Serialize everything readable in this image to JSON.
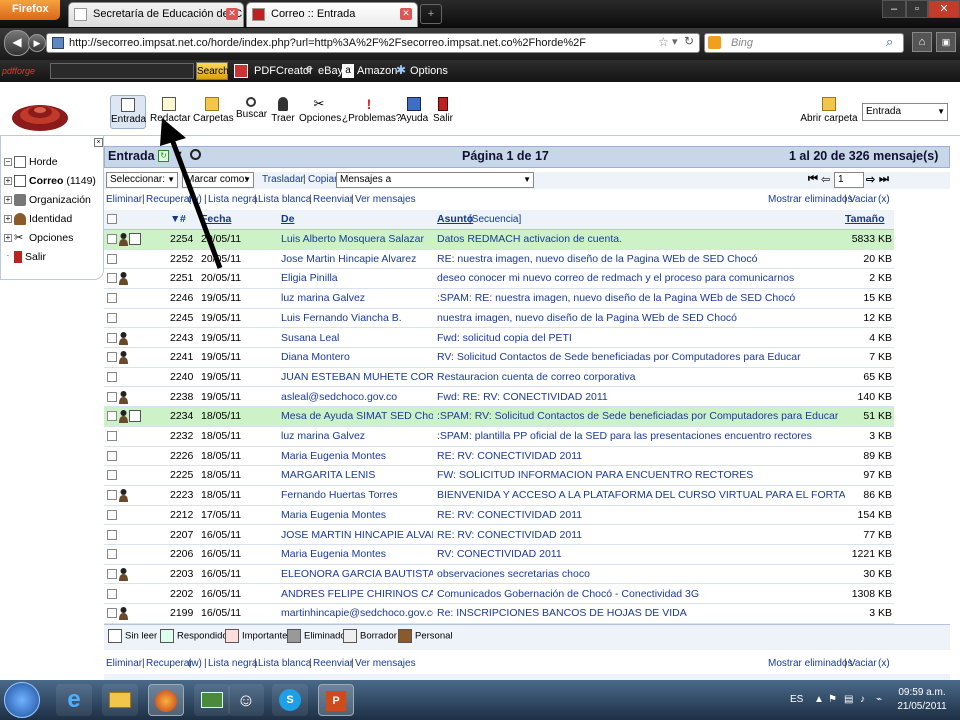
{
  "browser": {
    "app_button": "Firefox",
    "tabs": [
      {
        "label": "Secretaría de Educación del Chocó"
      },
      {
        "label": "Correo :: Entrada"
      }
    ],
    "url": "http://secorreo.impsat.net.co/horde/index.php?url=http%3A%2F%2Fsecorreo.impsat.net.co%2Fhorde%2F",
    "search_placeholder": "Bing",
    "bookmarks": {
      "search_placeholder": "",
      "search_button": "Search",
      "items": [
        "PDFCreator",
        "eBay",
        "Amazon",
        "Options"
      ]
    }
  },
  "toolbar": {
    "buttons": [
      "Entrada",
      "Redactar",
      "Carpetas",
      "Buscar",
      "Traer",
      "Opciones",
      "¿Problemas?",
      "Ayuda",
      "Salir"
    ],
    "open_folder": "Abrir carpeta",
    "folder_select": "Entrada"
  },
  "sidebar": {
    "items": [
      {
        "label": "Horde",
        "count": ""
      },
      {
        "label": "Correo",
        "count": "(1149)"
      },
      {
        "label": "Organización",
        "count": ""
      },
      {
        "label": "Identidad",
        "count": ""
      },
      {
        "label": "Opciones",
        "count": ""
      },
      {
        "label": "Salir",
        "count": ""
      }
    ]
  },
  "mailbox": {
    "title": "Entrada",
    "page": "Página 1 de 17",
    "range": "1 al 20 de 326 mensaje(s)",
    "select_label": "Seleccionar:",
    "mark_label": "Marcar como:",
    "move_label": "Trasladar",
    "copy_label": "Copiar",
    "messages_to": "Mensajes a",
    "page_input": "1",
    "actions": [
      "Eliminar",
      "Recuperar",
      "(w)",
      "Lista negra",
      "Lista blanca",
      "Reenviar",
      "Ver mensajes"
    ],
    "show_deleted": "Mostrar eliminados",
    "empty": "Vaciar",
    "empty_key": "(x)",
    "columns": {
      "num": "#",
      "date": "Fecha",
      "from": "De",
      "subject": "Asunto",
      "sequence": "[Secuencia]",
      "size": "Tamaño"
    },
    "rows": [
      {
        "num": "2254",
        "date": "20/05/11",
        "from": "Luis Alberto Mosquera Salazar",
        "subject": "Datos REDMACH activacion de cuenta.",
        "size": "5833 KB",
        "green": true,
        "person": true,
        "replied": true
      },
      {
        "num": "2252",
        "date": "20/05/11",
        "from": "Jose Martin Hincapie Alvarez",
        "subject": "RE: nuestra imagen, nuevo diseño de la Pagina WEb de SED Chocó",
        "size": "20 KB",
        "green": false,
        "person": false,
        "replied": false
      },
      {
        "num": "2251",
        "date": "20/05/11",
        "from": "Eligia Pinilla",
        "subject": "deseo conocer mi nuevo correo de redmach y el proceso para comunicarnos",
        "size": "2 KB",
        "green": false,
        "person": true,
        "replied": false
      },
      {
        "num": "2246",
        "date": "19/05/11",
        "from": "luz marina Galvez",
        "subject": ":SPAM: RE: nuestra imagen, nuevo diseño de la Pagina WEb de SED Chocó",
        "size": "15 KB",
        "green": false,
        "person": false,
        "replied": false
      },
      {
        "num": "2245",
        "date": "19/05/11",
        "from": "Luis Fernando Viancha B.",
        "subject": "nuestra imagen, nuevo diseño de la Pagina WEb de SED Chocó",
        "size": "12 KB",
        "green": false,
        "person": false,
        "replied": false
      },
      {
        "num": "2243",
        "date": "19/05/11",
        "from": "Susana Leal",
        "subject": "Fwd: solicitud copia del PETI",
        "size": "4 KB",
        "green": false,
        "person": true,
        "replied": false
      },
      {
        "num": "2241",
        "date": "19/05/11",
        "from": "Diana Montero",
        "subject": "RV: Solicitud Contactos de Sede beneficiadas por Computadores para Educar",
        "size": "7 KB",
        "green": false,
        "person": true,
        "replied": false
      },
      {
        "num": "2240",
        "date": "19/05/11",
        "from": "JUAN ESTEBAN MUHETE CORTES",
        "subject": "Restauracion cuenta de correo corporativa",
        "size": "65 KB",
        "green": false,
        "person": false,
        "replied": false
      },
      {
        "num": "2238",
        "date": "19/05/11",
        "from": "asleal@sedchoco.gov.co",
        "subject": "Fwd: RE: RV: CONECTIVIDAD 2011",
        "size": "140 KB",
        "green": false,
        "person": true,
        "replied": false
      },
      {
        "num": "2234",
        "date": "18/05/11",
        "from": "Mesa de Ayuda SIMAT SED Chocó",
        "subject": ":SPAM: RV: Solicitud Contactos de Sede beneficiadas por Computadores para Educar",
        "size": "51 KB",
        "green": true,
        "person": true,
        "replied": true
      },
      {
        "num": "2232",
        "date": "18/05/11",
        "from": "luz marina Galvez",
        "subject": ":SPAM: plantilla PP oficial de la SED  para las presentaciones encuentro rectores",
        "size": "3 KB",
        "green": false,
        "person": false,
        "replied": false
      },
      {
        "num": "2226",
        "date": "18/05/11",
        "from": "Maria Eugenia Montes",
        "subject": "RE: RV: CONECTIVIDAD 2011",
        "size": "89 KB",
        "green": false,
        "person": false,
        "replied": false
      },
      {
        "num": "2225",
        "date": "18/05/11",
        "from": "MARGARITA LENIS",
        "subject": "FW: SOLICITUD INFORMACION PARA ENCUENTRO RECTORES",
        "size": "97 KB",
        "green": false,
        "person": false,
        "replied": false
      },
      {
        "num": "2223",
        "date": "18/05/11",
        "from": "Fernando Huertas Torres",
        "subject": "BIENVENIDA Y ACCESO A LA PLATAFORMA DEL CURSO VIRTUAL PARA EL FORTALECIMIENTO DE LA ED",
        "size": "86 KB",
        "green": false,
        "person": true,
        "replied": false
      },
      {
        "num": "2212",
        "date": "17/05/11",
        "from": "Maria Eugenia Montes",
        "subject": "RE: RV: CONECTIVIDAD 2011",
        "size": "154 KB",
        "green": false,
        "person": false,
        "replied": false
      },
      {
        "num": "2207",
        "date": "16/05/11",
        "from": "JOSE MARTIN HINCAPIE ALVAREZ",
        "subject": "RE: RV: CONECTIVIDAD 2011",
        "size": "77 KB",
        "green": false,
        "person": false,
        "replied": false
      },
      {
        "num": "2206",
        "date": "16/05/11",
        "from": "Maria Eugenia Montes",
        "subject": "RV: CONECTIVIDAD 2011",
        "size": "1221 KB",
        "green": false,
        "person": false,
        "replied": false
      },
      {
        "num": "2203",
        "date": "16/05/11",
        "from": "ELEONORA GARCIA BAUTISTA",
        "subject": "observaciones secretarias choco",
        "size": "30 KB",
        "green": false,
        "person": true,
        "replied": false
      },
      {
        "num": "2202",
        "date": "16/05/11",
        "from": "ANDRES FELIPE CHIRINOS CADAVID",
        "subject": "Comunicados Gobernación de Chocó - Conectividad 3G",
        "size": "1308 KB",
        "green": false,
        "person": false,
        "replied": false
      },
      {
        "num": "2199",
        "date": "16/05/11",
        "from": "martinhincapie@sedchoco.gov.co",
        "subject": "Re: INSCRIPCIONES BANCOS DE HOJAS DE VIDA",
        "size": "3 KB",
        "green": false,
        "person": true,
        "replied": false
      }
    ],
    "legend": [
      "Sin leer",
      "Respondido",
      "Importante",
      "Eliminado",
      "Borrador",
      "Personal"
    ]
  },
  "taskbar": {
    "lang": "ES",
    "time": "09:59 a.m.",
    "date": "21/05/2011"
  },
  "colors": {
    "green_row": "#cef2c8",
    "link_blue": "#1a3b9a",
    "header_blue": "#c8d6ea"
  }
}
